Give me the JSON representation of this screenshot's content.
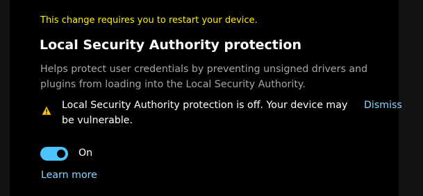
{
  "restart_notice": "This change requires you to restart your device.",
  "setting": {
    "title": "Local Security Authority protection",
    "description": "Helps protect user credentials by preventing unsigned drivers and plugins from loading into the Local Security Authority.",
    "toggle_state_label": "On",
    "toggle_on": true,
    "learn_more_label": "Learn more"
  },
  "warning": {
    "icon": "warning-triangle-icon",
    "message": "Local Security Authority protection is off. Your device may be vulnerable.",
    "dismiss_label": "Dismiss"
  },
  "colors": {
    "background": "#000000",
    "notice": "#fff200",
    "accent": "#4cc2ff",
    "link": "#8dd6ff",
    "warning_icon": "#fcc419",
    "secondary_text": "#a6a6a6"
  }
}
